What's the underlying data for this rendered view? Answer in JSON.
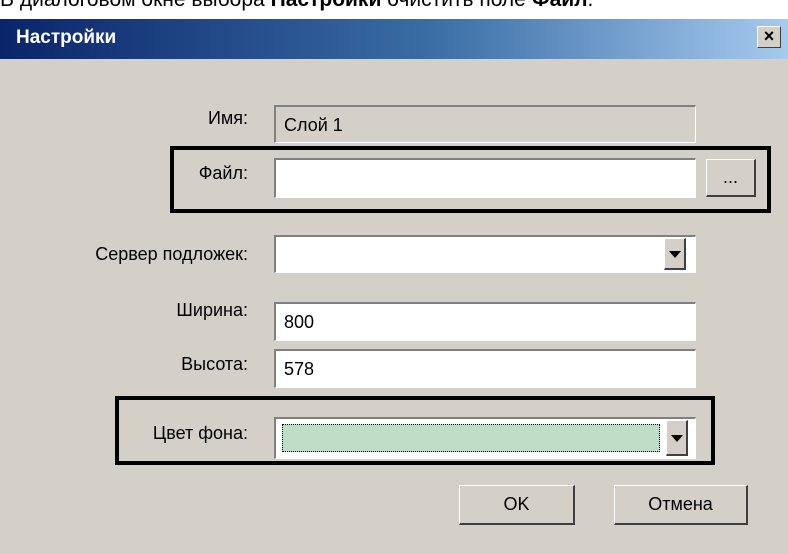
{
  "caption": {
    "prefix": "В диалоговом окне выбора ",
    "dialog_name": "Настройки",
    "middle": " очистить поле ",
    "field_name": "Файл",
    "suffix": "."
  },
  "dialog": {
    "title": "Настройки",
    "close_label": "×"
  },
  "form": {
    "name_label": "Имя:",
    "name_value": "Слой 1",
    "file_label": "Файл:",
    "file_value": "",
    "browse_label": "...",
    "server_label": "Сервер подложек:",
    "server_value": "",
    "width_label": "Ширина:",
    "width_value": "800",
    "height_label": "Высота:",
    "height_value": "578",
    "bg_color_label": "Цвет фона:",
    "bg_color_value": "#bfdec8"
  },
  "buttons": {
    "ok": "OK",
    "cancel": "Отмена"
  }
}
